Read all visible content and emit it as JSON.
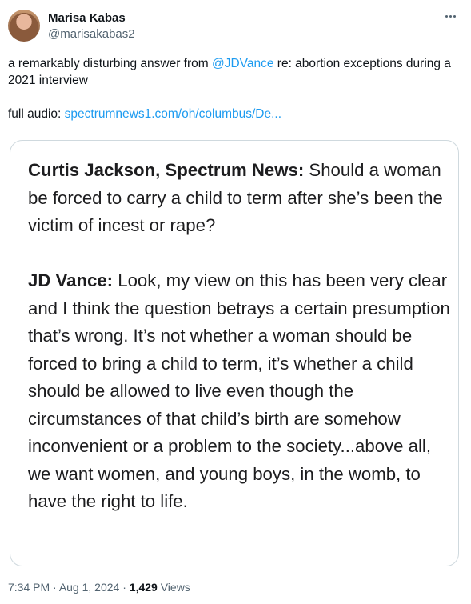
{
  "author": {
    "display_name": "Marisa Kabas",
    "handle": "@marisakabas2"
  },
  "tweet": {
    "text_part1": "a remarkably disturbing answer from ",
    "mention": "@JDVance",
    "text_part2": " re: abortion exceptions during a 2021 interview",
    "audio_label": "full audio: ",
    "audio_link": "spectrumnews1.com/oh/columbus/De..."
  },
  "media": {
    "q_speaker": "Curtis Jackson, Spectrum News:",
    "q_text": " Should a woman be forced to carry a child to term after she’s been the victim of incest or rape?",
    "a_speaker": "JD Vance:",
    "a_text": " Look, my view on this has been very clear and I think the question betrays a certain presumption that’s wrong. It’s not whether a woman should be forced to bring a child to term, it’s whether a child should be allowed to live even though the circumstances of that child’s birth are somehow inconvenient or a problem to the society...above all, we want women, and young boys, in the womb, to have the right to life."
  },
  "meta": {
    "time": "7:34 PM",
    "sep1": " · ",
    "date": "Aug 1, 2024",
    "sep2": " · ",
    "views_count": "1,429",
    "views_label": " Views"
  },
  "icons": {
    "more": "more-horizontal-icon",
    "avatar": "profile-photo"
  }
}
